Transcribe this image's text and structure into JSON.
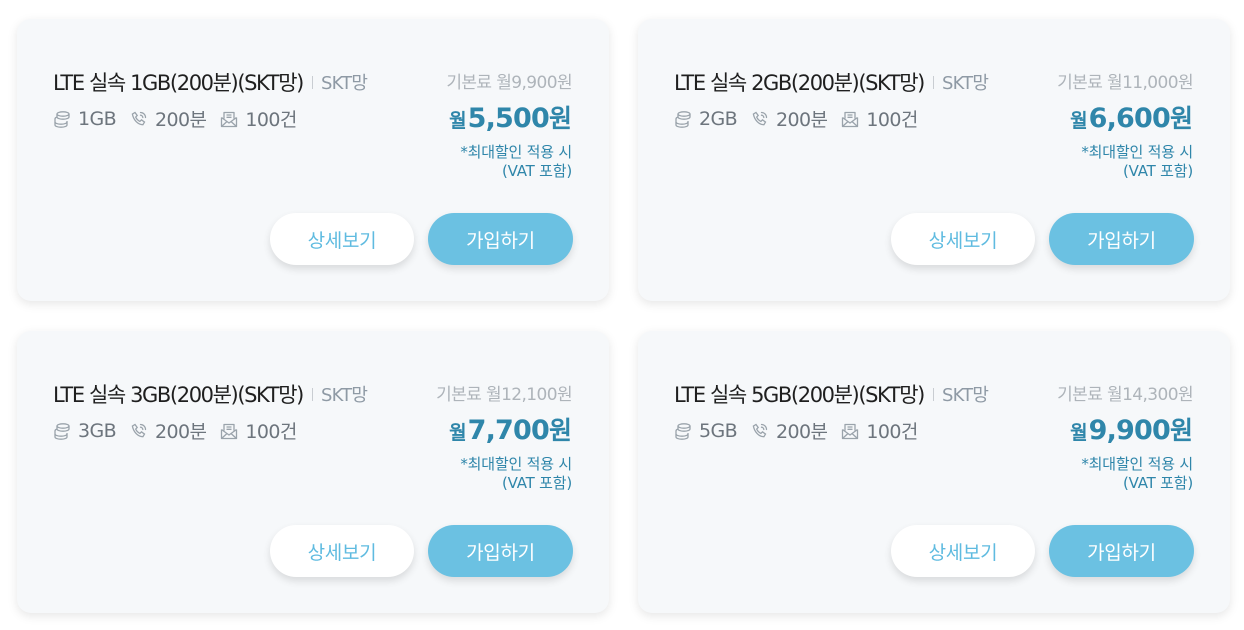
{
  "plans": [
    {
      "name": "LTE 실속 1GB(200분)(SKT망)",
      "network": "SKT망",
      "base_price": "기본료 월9,900원",
      "specs": {
        "data": "1GB",
        "voice": "200분",
        "sms": "100건"
      },
      "price": {
        "prefix": "월",
        "amount": "5,500",
        "suffix": "원"
      },
      "notice": [
        "*최대할인 적용 시",
        "(VAT 포함)"
      ],
      "detail_label": "상세보기",
      "join_label": "가입하기"
    },
    {
      "name": "LTE 실속 2GB(200분)(SKT망)",
      "network": "SKT망",
      "base_price": "기본료 월11,000원",
      "specs": {
        "data": "2GB",
        "voice": "200분",
        "sms": "100건"
      },
      "price": {
        "prefix": "월",
        "amount": "6,600",
        "suffix": "원"
      },
      "notice": [
        "*최대할인 적용 시",
        "(VAT 포함)"
      ],
      "detail_label": "상세보기",
      "join_label": "가입하기"
    },
    {
      "name": "LTE 실속 3GB(200분)(SKT망)",
      "network": "SKT망",
      "base_price": "기본료 월12,100원",
      "specs": {
        "data": "3GB",
        "voice": "200분",
        "sms": "100건"
      },
      "price": {
        "prefix": "월",
        "amount": "7,700",
        "suffix": "원"
      },
      "notice": [
        "*최대할인 적용 시",
        "(VAT 포함)"
      ],
      "detail_label": "상세보기",
      "join_label": "가입하기"
    },
    {
      "name": "LTE 실속 5GB(200분)(SKT망)",
      "network": "SKT망",
      "base_price": "기본료 월14,300원",
      "specs": {
        "data": "5GB",
        "voice": "200분",
        "sms": "100건"
      },
      "price": {
        "prefix": "월",
        "amount": "9,900",
        "suffix": "원"
      },
      "notice": [
        "*최대할인 적용 시",
        "(VAT 포함)"
      ],
      "detail_label": "상세보기",
      "join_label": "가입하기"
    }
  ],
  "icons": {
    "data": "data-stack-icon",
    "voice": "phone-icon",
    "sms": "envelope-icon"
  },
  "colors": {
    "accent": "#2f86aa",
    "button_primary": "#6bc1e2",
    "button_secondary_text": "#5fbbe0",
    "card_bg": "#f6f8fa"
  }
}
